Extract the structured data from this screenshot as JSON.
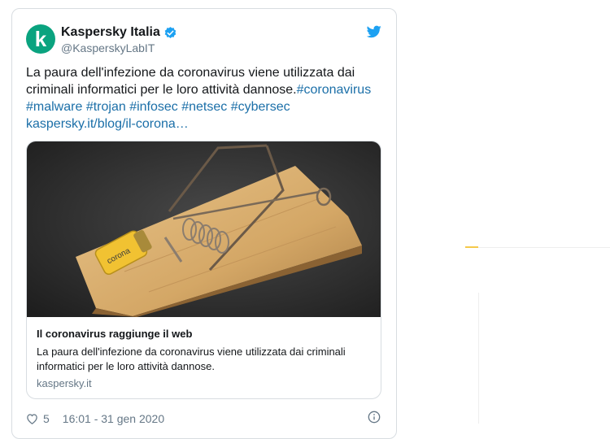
{
  "tweet": {
    "display_name": "Kaspersky Italia",
    "handle": "@KasperskyLabIT",
    "avatar_letter": "k",
    "brand_color": "#0aa37f",
    "text_plain": "La paura dell'infezione da coronavirus viene utilizzata dai criminali informatici per le loro attività dannose.",
    "hashtag_1": "#coronavirus",
    "hashtag_2": "#malware",
    "hashtag_3": "#trojan",
    "hashtag_4": "#infosec",
    "hashtag_5": "#netsec",
    "hashtag_6": "#cybersec",
    "link_text": "kaspersky.it/blog/il-corona…",
    "link_color": "#1b6fa8",
    "card": {
      "title": "Il coronavirus raggiunge il web",
      "description": "La paura dell'infezione da coronavirus viene utilizzata dai criminali informatici per le loro attività dannose.",
      "domain": "kaspersky.it",
      "image_label": "corona"
    },
    "likes": "5",
    "timestamp": "16:01 - 31 gen 2020",
    "icons": {
      "verified": "verified-badge-icon",
      "bird": "twitter-bird-icon",
      "heart": "heart-icon",
      "info": "info-icon"
    }
  }
}
